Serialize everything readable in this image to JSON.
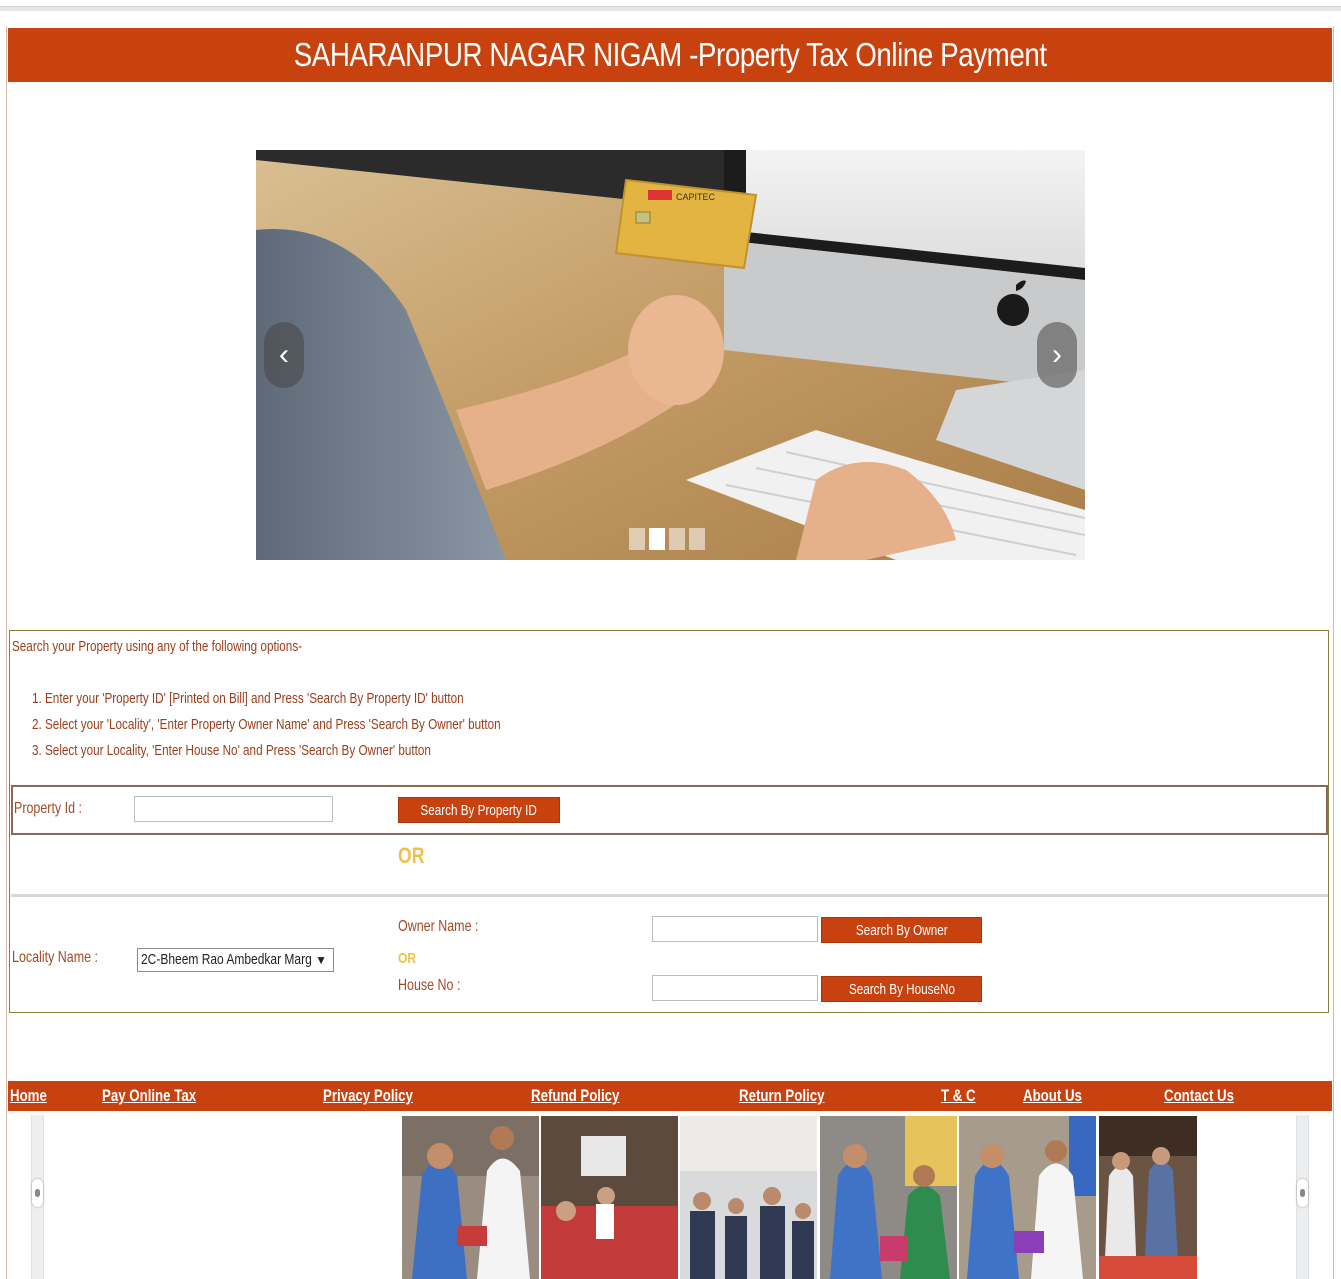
{
  "header": {
    "title": "SAHARANPUR NAGAR NIGAM -Property Tax Online Payment"
  },
  "carousel": {
    "prev_label": "‹",
    "next_label": "›",
    "indicator_count": 4,
    "active_index": 1,
    "card_brand": "CAPITEC"
  },
  "search": {
    "intro": "Search your Property using any of the following options-",
    "steps": [
      "1. Enter your 'Property ID' [Printed on Bill] and Press 'Search By Property ID' button",
      "2. Select your 'Locality', 'Enter Property Owner Name' and Press 'Search By Owner' button",
      "3. Select your Locality, 'Enter House No' and Press 'Search By Owner' button"
    ],
    "property_id_label": "Property Id :",
    "property_id_value": "",
    "search_by_property_button": "Search  By Property ID",
    "or_big": "OR",
    "locality_label": "Locality Name :",
    "locality_selected": "2C-Bheem Rao Ambedkar Marg",
    "owner_name_label": "Owner Name :",
    "owner_name_value": "",
    "search_by_owner_button": "Search By Owner",
    "or_small": "OR",
    "house_no_label": "House No :",
    "house_no_value": "",
    "search_by_house_button": "Search By HouseNo"
  },
  "footer_nav": [
    "Home",
    "Pay Online Tax",
    "Privacy Policy",
    "Refund Policy",
    "Return Policy",
    "T & C",
    "About Us",
    "Contact Us"
  ],
  "colors": {
    "brand": "#c7420f",
    "accent_or": "#f0c14a",
    "label_text": "#a24b22"
  }
}
